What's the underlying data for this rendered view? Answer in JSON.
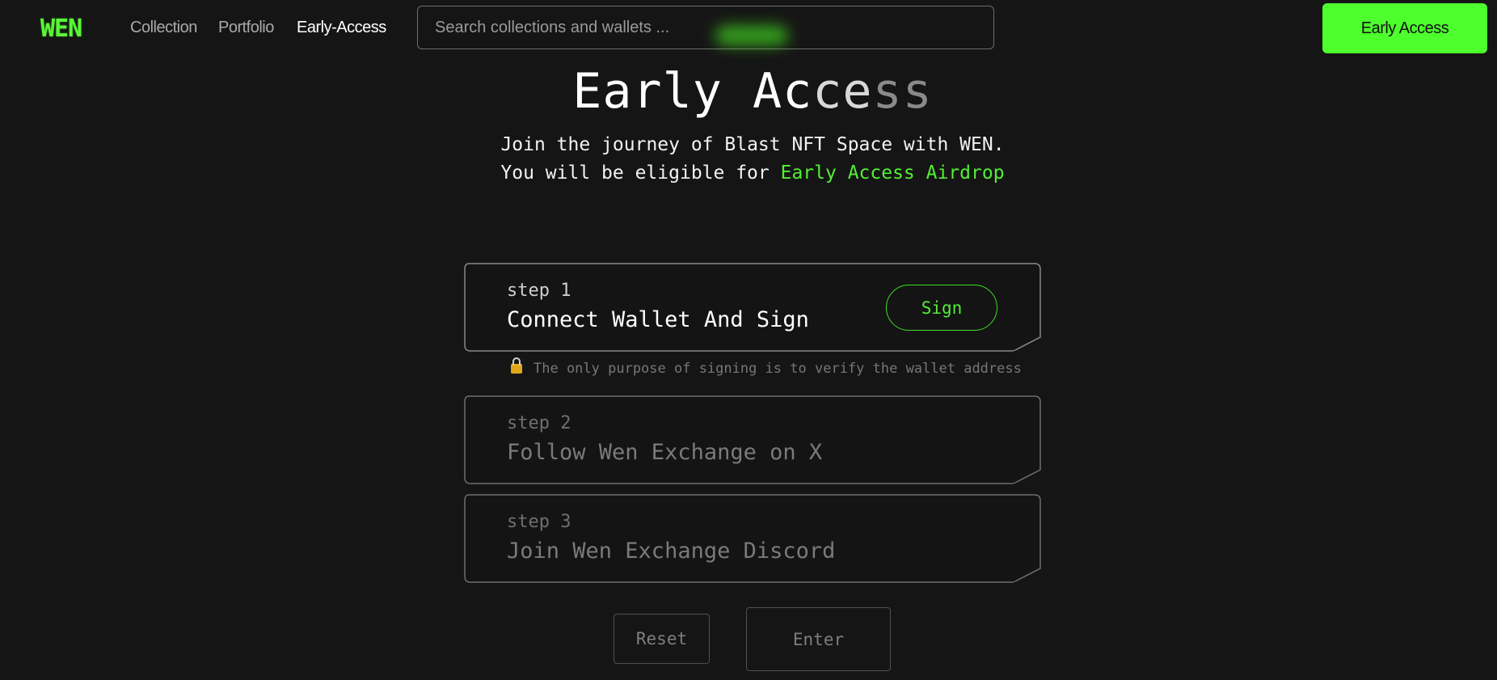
{
  "nav": {
    "logo": "WEN",
    "links": [
      "Collection",
      "Portfolio",
      "Early-Access"
    ],
    "search_placeholder": "Search collections and wallets ...",
    "cta_label": "Early Access"
  },
  "hero": {
    "title_a": "Early Ac",
    "title_b": "ce",
    "title_c": "ss",
    "line1": "Join the journey of Blast NFT Space with WEN.",
    "line2_prefix": "You will be eligible for ",
    "line2_highlight": "Early Access Airdrop"
  },
  "steps": [
    {
      "label": "step 1",
      "text": "Connect Wallet And Sign",
      "button": "Sign"
    },
    {
      "label": "step 2",
      "text": "Follow Wen Exchange on X"
    },
    {
      "label": "step 3",
      "text": "Join Wen Exchange Discord"
    }
  ],
  "note": {
    "icon": "lock-icon",
    "text": "The only purpose of signing is to verify the wallet address"
  },
  "actions": {
    "reset": "Reset",
    "enter": "Enter"
  },
  "colors": {
    "accent": "#4dff2d",
    "background": "#151515"
  }
}
